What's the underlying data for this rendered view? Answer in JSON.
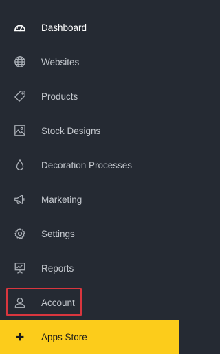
{
  "sidebar": {
    "items": [
      {
        "label": "Dashboard",
        "icon": "speedometer-icon",
        "active": true
      },
      {
        "label": "Websites",
        "icon": "globe-icon"
      },
      {
        "label": "Products",
        "icon": "tag-icon"
      },
      {
        "label": "Stock Designs",
        "icon": "image-icon"
      },
      {
        "label": "Decoration Processes",
        "icon": "droplet-icon"
      },
      {
        "label": "Marketing",
        "icon": "megaphone-icon"
      },
      {
        "label": "Settings",
        "icon": "gear-icon"
      },
      {
        "label": "Reports",
        "icon": "chart-board-icon"
      },
      {
        "label": "Account",
        "icon": "user-icon",
        "highlighted": true
      }
    ],
    "apps_store": {
      "label": "Apps Store",
      "icon": "plus-icon",
      "background": "#fccc1b"
    }
  },
  "colors": {
    "sidebar_bg": "#252a33",
    "text": "#c4c8ce",
    "active_text": "#ffffff",
    "highlight_border": "#d9363e"
  }
}
